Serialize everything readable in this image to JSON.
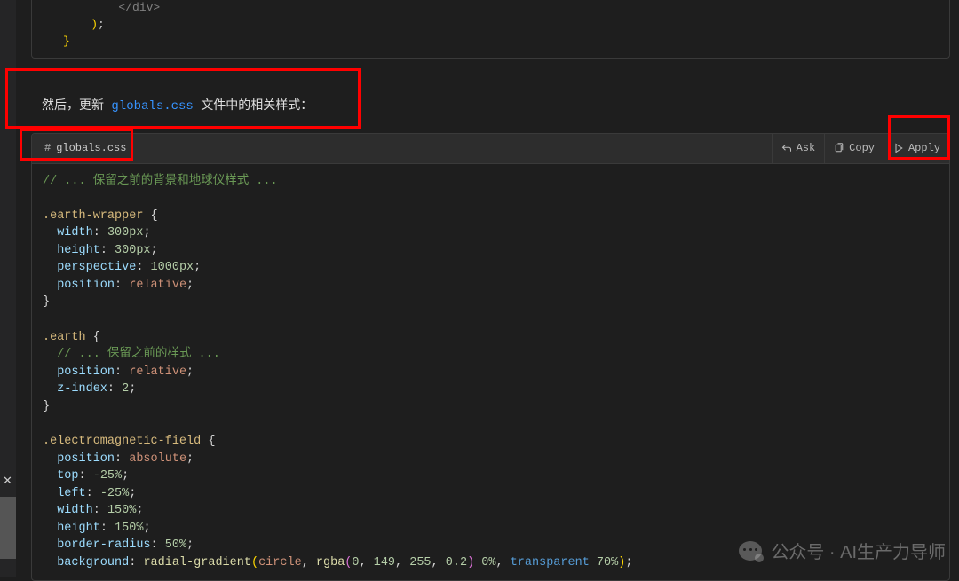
{
  "prev_code": {
    "l1": "</div>",
    "l2": ");",
    "l3": "}"
  },
  "message": {
    "before": "然后，更新 ",
    "filename": "globals.css",
    "after": " 文件中的相关样式："
  },
  "codeblock": {
    "tab_icon": "#",
    "tab_label": "globals.css",
    "actions": {
      "ask": "Ask",
      "copy": "Copy",
      "apply": "Apply"
    },
    "css": {
      "comment1": "// ... 保留之前的背景和地球仪样式 ...",
      "sel1": ".earth-wrapper",
      "p_width": "width",
      "v_300px": "300px",
      "p_height": "height",
      "p_perspective": "perspective",
      "v_1000px": "1000px",
      "p_position": "position",
      "v_relative": "relative",
      "sel2": ".earth",
      "comment2": "// ... 保留之前的样式 ...",
      "p_zindex": "z-index",
      "v_2": "2",
      "sel3": ".electromagnetic-field",
      "v_absolute": "absolute",
      "p_top": "top",
      "v_n25": "-25%",
      "p_left": "left",
      "v_150": "150%",
      "p_bradius": "border-radius",
      "v_50": "50%",
      "p_bg": "background",
      "v_bg_func": "radial-gradient",
      "v_circle": "circle",
      "v_rgba": "rgba",
      "v_r": "0",
      "v_g": "149",
      "v_b": "255",
      "v_a": "0.2",
      "v_stop0": "0%",
      "v_transparent": "transparent",
      "v_stop70": "70%"
    }
  },
  "watermark": {
    "text": "公众号 · AI生产力导师"
  }
}
